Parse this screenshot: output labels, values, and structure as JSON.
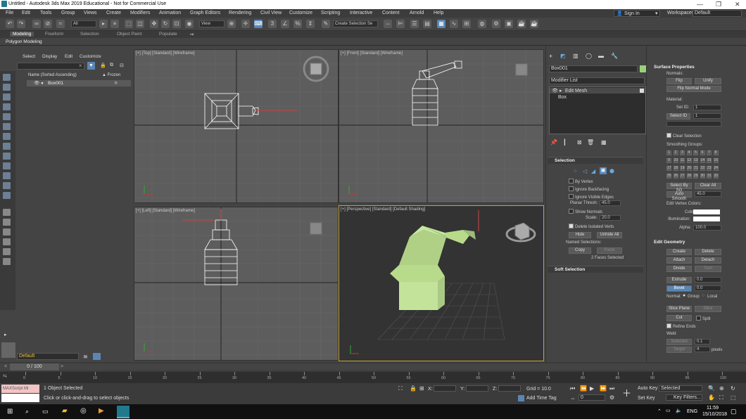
{
  "window": {
    "title": "Untitled - Autodesk 3ds Max 2019 Educational - Not for Commercial Use"
  },
  "menu": [
    "File",
    "Edit",
    "Tools",
    "Group",
    "Views",
    "Create",
    "Modifiers",
    "Animation",
    "Graph Editors",
    "Rendering",
    "Civil View",
    "Customize",
    "Scripting",
    "Interactive",
    "Content",
    "Arnold",
    "Help"
  ],
  "account": {
    "sign_in": "Sign In",
    "workspaces_label": "Workspaces:",
    "workspace": "Default"
  },
  "toolbar": {
    "filter": "All",
    "view": "View",
    "selection_set": "Create Selection Se"
  },
  "ribbon": {
    "tabs": [
      "Modeling",
      "Freeform",
      "Selection",
      "Object Paint",
      "Populate"
    ],
    "sub": "Polygon Modeling"
  },
  "scene_explorer": {
    "tabs": [
      "Select",
      "Display",
      "Edit",
      "Customize"
    ],
    "col_name": "Name (Sorted Ascending)",
    "col_frozen": "▲ Frozen",
    "rows": [
      "Box001"
    ]
  },
  "viewports": [
    {
      "label": "[+] [Top] [Standard] [Wireframe]"
    },
    {
      "label": "[+] [Front] [Standard] [Wireframe]"
    },
    {
      "label": "[+] [Left] [Standard] [Wireframe]"
    },
    {
      "label": "[+] [Perspective] [Standard] [Default Shading]"
    }
  ],
  "command_panel": {
    "object_name": "Box001",
    "modifier_list": "Modifier List",
    "stack": [
      "Edit Mesh",
      "Box"
    ],
    "selection": {
      "title": "Selection",
      "by_vertex": "By Vertex",
      "ignore_backfacing": "Ignore Backfacing",
      "ignore_visible_edges": "Ignore Visible Edges",
      "planar_thresh_label": "Planar Thresh:",
      "planar_thresh": "45.0",
      "show_normals": "Show Normals",
      "scale_label": "Scale:",
      "scale": "20.0",
      "delete_isolated": "Delete Isolated Verts",
      "hide": "Hide",
      "unhide_all": "Unhide All",
      "named_selections": "Named Selections:",
      "copy": "Copy",
      "paste": "Paste",
      "status": "2 Faces Selected"
    },
    "soft_selection": "Soft Selection"
  },
  "properties": {
    "surface_title": "Surface Properties",
    "normals_label": "Normals:",
    "flip": "Flip",
    "unify": "Unify",
    "flip_normal_mode": "Flip Normal Mode",
    "material_label": "Material:",
    "set_id_label": "Set ID:",
    "set_id": "1",
    "select_id": "Select ID",
    "select_id_val": "1",
    "clear_selection": "Clear Selection",
    "smoothing_groups": "Smoothing Groups:",
    "sg": [
      "1",
      "2",
      "3",
      "4",
      "5",
      "6",
      "7",
      "8",
      "9",
      "10",
      "11",
      "12",
      "13",
      "14",
      "15",
      "16",
      "17",
      "18",
      "19",
      "20",
      "21",
      "22",
      "23",
      "24",
      "25",
      "26",
      "27",
      "28",
      "29",
      "30",
      "31",
      "32"
    ],
    "select_by_sg": "Select By SG",
    "clear_all": "Clear All",
    "auto_smooth": "Auto Smooth",
    "auto_smooth_val": "45.0",
    "edit_vertex_colors": "Edit Vertex Colors:",
    "color_label": "Color:",
    "illumination_label": "Illumination:",
    "alpha_label": "Alpha:",
    "alpha": "100.0",
    "edit_geometry": "Edit Geometry",
    "create": "Create",
    "delete": "Delete",
    "attach": "Attach",
    "detach": "Detach",
    "divide": "Divide",
    "turn": "Turn",
    "extrude": "Extrude",
    "extrude_val": "0.0",
    "bevel": "Bevel",
    "bevel_val": "0.0",
    "normal_label": "Normal:",
    "group": "Group",
    "local": "Local",
    "slice_plane": "Slice Plane",
    "slice": "Slice",
    "cut": "Cut",
    "split": "Split",
    "refine_ends": "Refine Ends",
    "weld": "Weld",
    "selected": "Selected",
    "selected_val": "0.1",
    "target": "Target",
    "target_val": "4",
    "pixels": "pixels"
  },
  "bottom": {
    "layer": "Default",
    "frame": "0 / 100",
    "ticks": [
      "0",
      "5",
      "10",
      "15",
      "20",
      "25",
      "30",
      "35",
      "40",
      "45",
      "50",
      "55",
      "60",
      "65",
      "70",
      "75",
      "80",
      "85",
      "90",
      "95",
      "100"
    ],
    "maxscript": "MAXScript Mi",
    "status1": "1 Object Selected",
    "status2": "Click or click-and-drag to select objects",
    "x_label": "X:",
    "y_label": "Y:",
    "z_label": "Z:",
    "grid": "Grid = 10.0",
    "add_time_tag": "Add Time Tag",
    "frame_val": "0",
    "auto_key": "Auto Key",
    "set_key": "Set Key",
    "selected": "Selected",
    "key_filters": "Key Filters..."
  },
  "taskbar": {
    "lang": "ENG",
    "time": "11:59",
    "date": "15/10/2018"
  }
}
